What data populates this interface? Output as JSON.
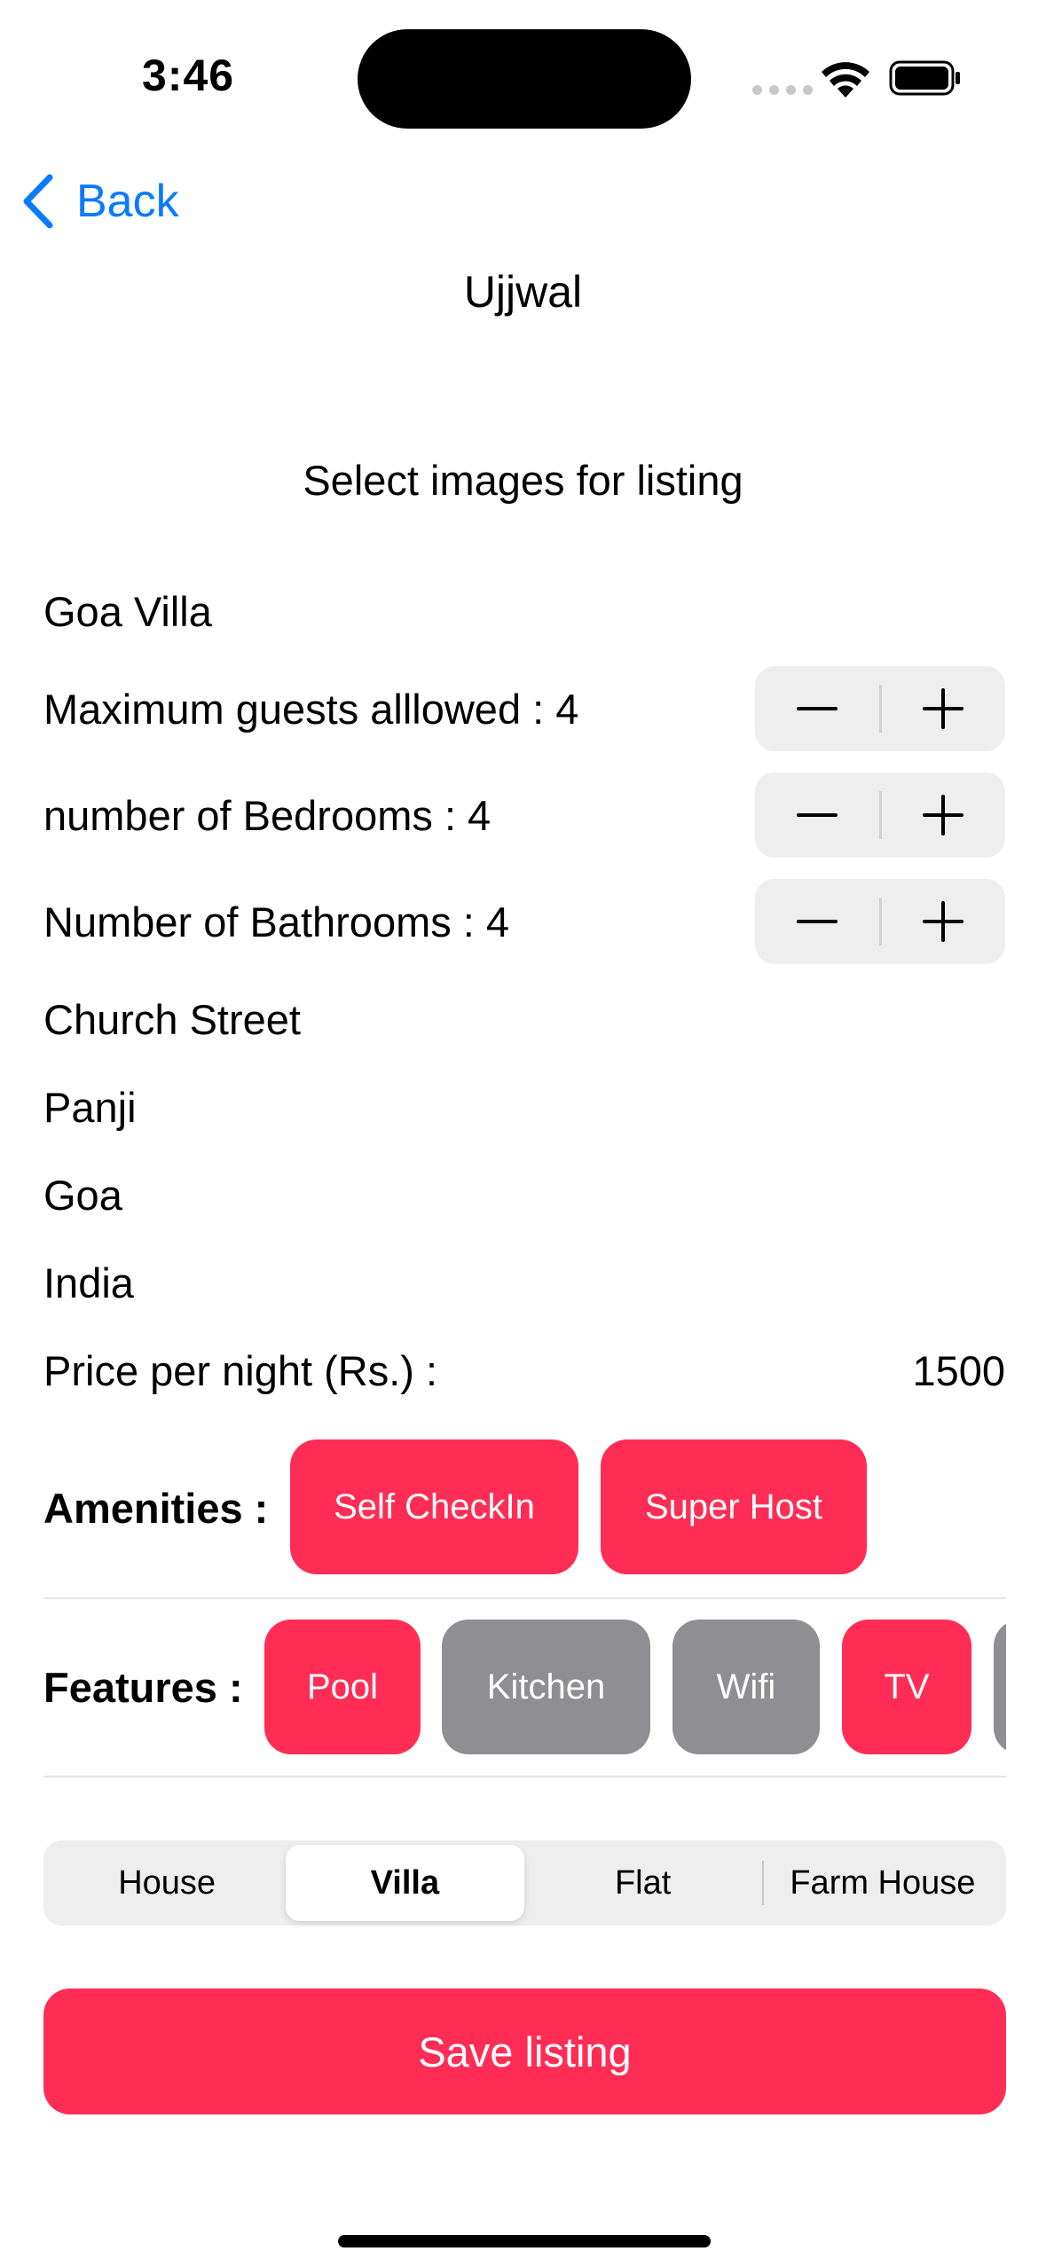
{
  "status_bar": {
    "time": "3:46"
  },
  "nav": {
    "back_label": "Back",
    "title": "Ujjwal"
  },
  "select_images_label": "Select images for listing",
  "listing": {
    "name": "Goa Villa",
    "guests_label": "Maximum guests alllowed : 4",
    "bedrooms_label": "number of Bedrooms : 4",
    "bathrooms_label": "Number of Bathrooms : 4",
    "street": "Church Street",
    "city": "Panji",
    "state": "Goa",
    "country": "India",
    "price_label": "Price per night (Rs.) :",
    "price_value": "1500"
  },
  "amenities": {
    "label": "Amenities :",
    "items": [
      {
        "label": "Self CheckIn",
        "selected": true
      },
      {
        "label": "Super Host",
        "selected": true
      }
    ]
  },
  "features": {
    "label": "Features :",
    "items": [
      {
        "label": "Pool",
        "selected": true
      },
      {
        "label": "Kitchen",
        "selected": false
      },
      {
        "label": "Wifi",
        "selected": false
      },
      {
        "label": "TV",
        "selected": true
      },
      {
        "label": "",
        "selected": false
      }
    ]
  },
  "property_type": {
    "options": [
      "House",
      "Villa",
      "Flat",
      "Farm House"
    ],
    "selected": "Villa"
  },
  "save_label": "Save listing",
  "colors": {
    "accent": "#ff2d55",
    "link": "#0a7aff",
    "inactive": "#8e8e93"
  }
}
